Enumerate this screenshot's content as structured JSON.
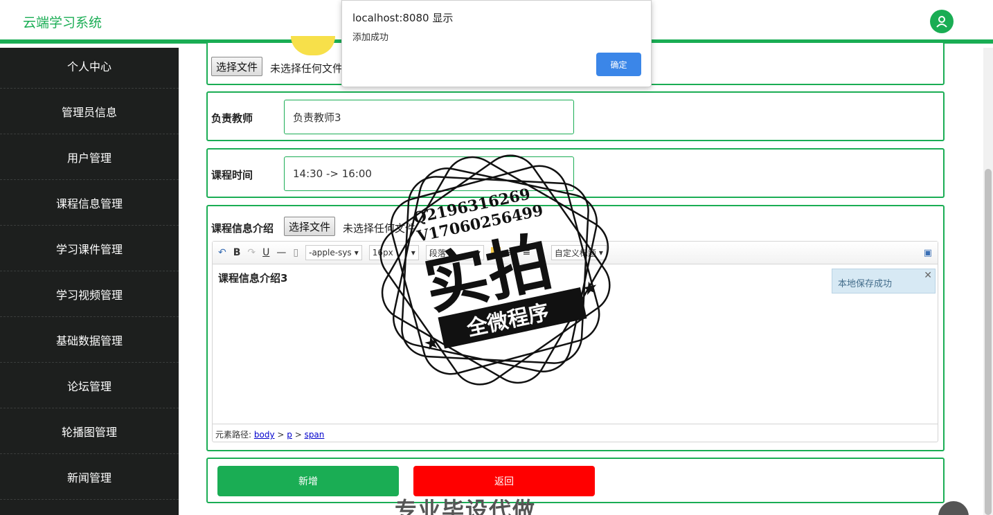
{
  "header": {
    "brand": "云端学习系统",
    "avatar_icon": "user-icon"
  },
  "sidebar": {
    "items": [
      {
        "label": "个人中心"
      },
      {
        "label": "管理员信息"
      },
      {
        "label": "用户管理"
      },
      {
        "label": "课程信息管理"
      },
      {
        "label": "学习课件管理"
      },
      {
        "label": "学习视频管理"
      },
      {
        "label": "基础数据管理"
      },
      {
        "label": "论坛管理"
      },
      {
        "label": "轮播图管理"
      },
      {
        "label": "新闻管理"
      }
    ]
  },
  "form": {
    "image_upload": {
      "button": "选择文件",
      "status": "未选择任何文件"
    },
    "teacher": {
      "label": "负责教师",
      "value": "负责教师3"
    },
    "time": {
      "label": "课程时间",
      "value": "14:30  -> 16:00"
    },
    "intro": {
      "label": "课程信息介绍",
      "file_button": "选择文件",
      "file_status": "未选择任何文件",
      "toolbar": {
        "font_family": "-apple-sys",
        "font_size": "16px",
        "paragraph": "段落",
        "custom_title": "自定义标题"
      },
      "content": "课程信息介绍3",
      "tip": "本地保存成功",
      "path_label": "元素路径:",
      "path": [
        "body",
        "p",
        "span"
      ]
    },
    "buttons": {
      "add": "新增",
      "back": "返回"
    }
  },
  "dialog": {
    "title": "localhost:8080 显示",
    "message": "添加成功",
    "ok": "确定"
  },
  "watermark": {
    "line1": "Q2196316269",
    "line2": "V17060256499",
    "main": "实拍",
    "banner": "全微程序",
    "bottom": "专业毕设代做"
  },
  "colors": {
    "accent": "#1aad54",
    "danger": "#ff0000",
    "sidebar_bg": "#1d1f1e",
    "dialog_button": "#3b86e8"
  }
}
